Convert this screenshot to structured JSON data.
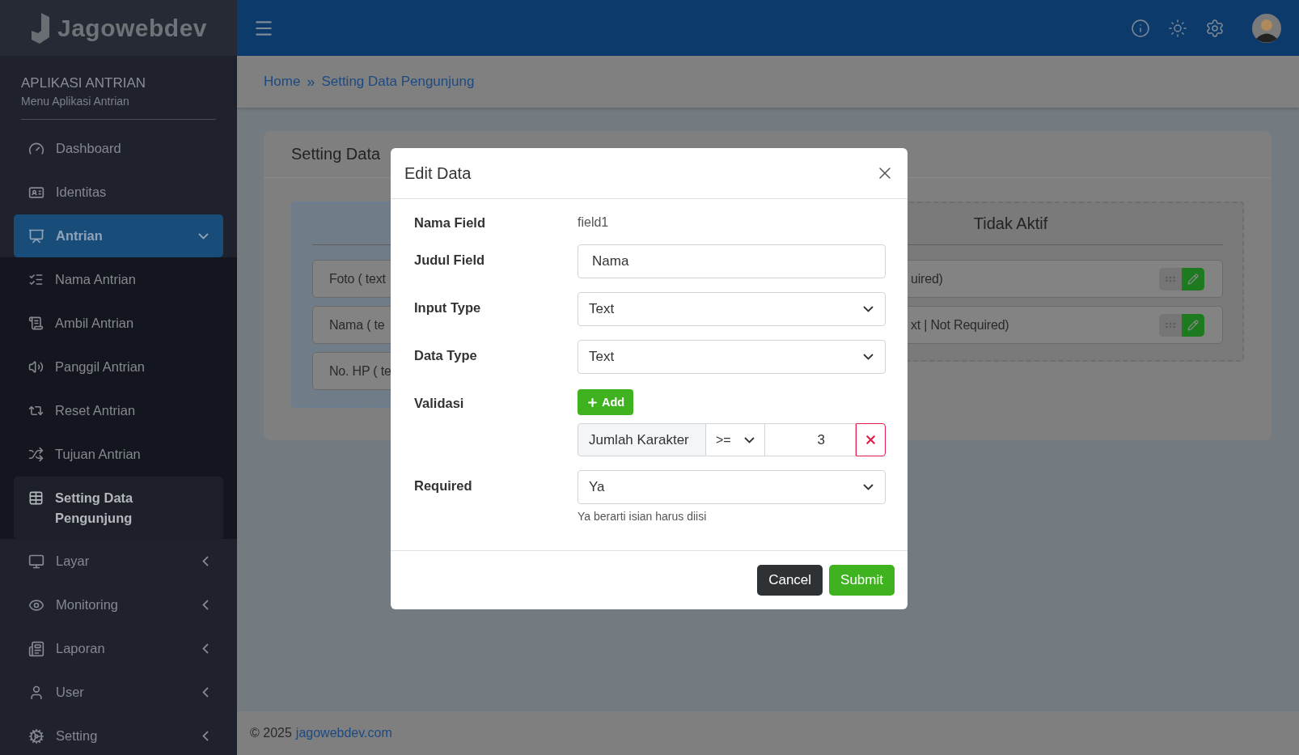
{
  "brand": {
    "name": "Jagowebdev"
  },
  "sidebar": {
    "heading": "APLIKASI ANTRIAN",
    "subheading": "Menu Aplikasi Antrian",
    "items": [
      {
        "label": "Dashboard",
        "selected": false
      },
      {
        "label": "Identitas",
        "selected": false
      },
      {
        "label": "Antrian",
        "selected": false,
        "expanded": true,
        "children": [
          {
            "label": "Nama Antrian",
            "selected": false
          },
          {
            "label": "Ambil Antrian",
            "selected": false
          },
          {
            "label": "Panggil Antrian",
            "selected": false
          },
          {
            "label": "Reset Antrian",
            "selected": false
          },
          {
            "label": "Tujuan Antrian",
            "selected": false
          },
          {
            "label": "Setting Data Pengunjung",
            "selected": true
          }
        ]
      },
      {
        "label": "Layar",
        "selected": false,
        "expanded": false
      },
      {
        "label": "Monitoring",
        "selected": false,
        "expanded": false
      },
      {
        "label": "Laporan",
        "selected": false,
        "expanded": false
      },
      {
        "label": "User",
        "selected": false,
        "expanded": false
      },
      {
        "label": "Setting",
        "selected": false,
        "expanded": false
      }
    ]
  },
  "breadcrumb": {
    "items": [
      "Home",
      "Setting Data Pengunjung"
    ],
    "separator": "»"
  },
  "card": {
    "title": "Setting Data",
    "columns": [
      {
        "items": [
          "Foto ( text",
          "Nama ( te",
          "No. HP ( te"
        ]
      },
      {
        "title": "Tidak Aktif",
        "actions": true,
        "items": [
          "uired)",
          "xt | Not Required)"
        ]
      }
    ]
  },
  "footer": {
    "copyright": "© 2025",
    "link": "jagowebdev.com"
  },
  "modal": {
    "title": "Edit Data",
    "fields": [
      {
        "label": "Nama Field",
        "kind": "static",
        "value": "field1"
      },
      {
        "label": "Judul Field",
        "kind": "input",
        "value": "Nama"
      },
      {
        "label": "Input Type",
        "kind": "select",
        "value": "Text"
      },
      {
        "label": "Data Type",
        "kind": "select",
        "value": "Text"
      },
      {
        "label": "Validasi",
        "kind": "validation",
        "add_label": "Add",
        "rules": [
          {
            "name": "Jumlah Karakter",
            "operator": ">=",
            "value": "3"
          }
        ]
      },
      {
        "label": "Required",
        "kind": "select",
        "value": "Ya",
        "help": "Ya berarti isian harus diisi"
      }
    ],
    "buttons": [
      {
        "label": "Cancel",
        "kind": "secondary"
      },
      {
        "label": "Submit",
        "kind": "primary"
      }
    ]
  }
}
